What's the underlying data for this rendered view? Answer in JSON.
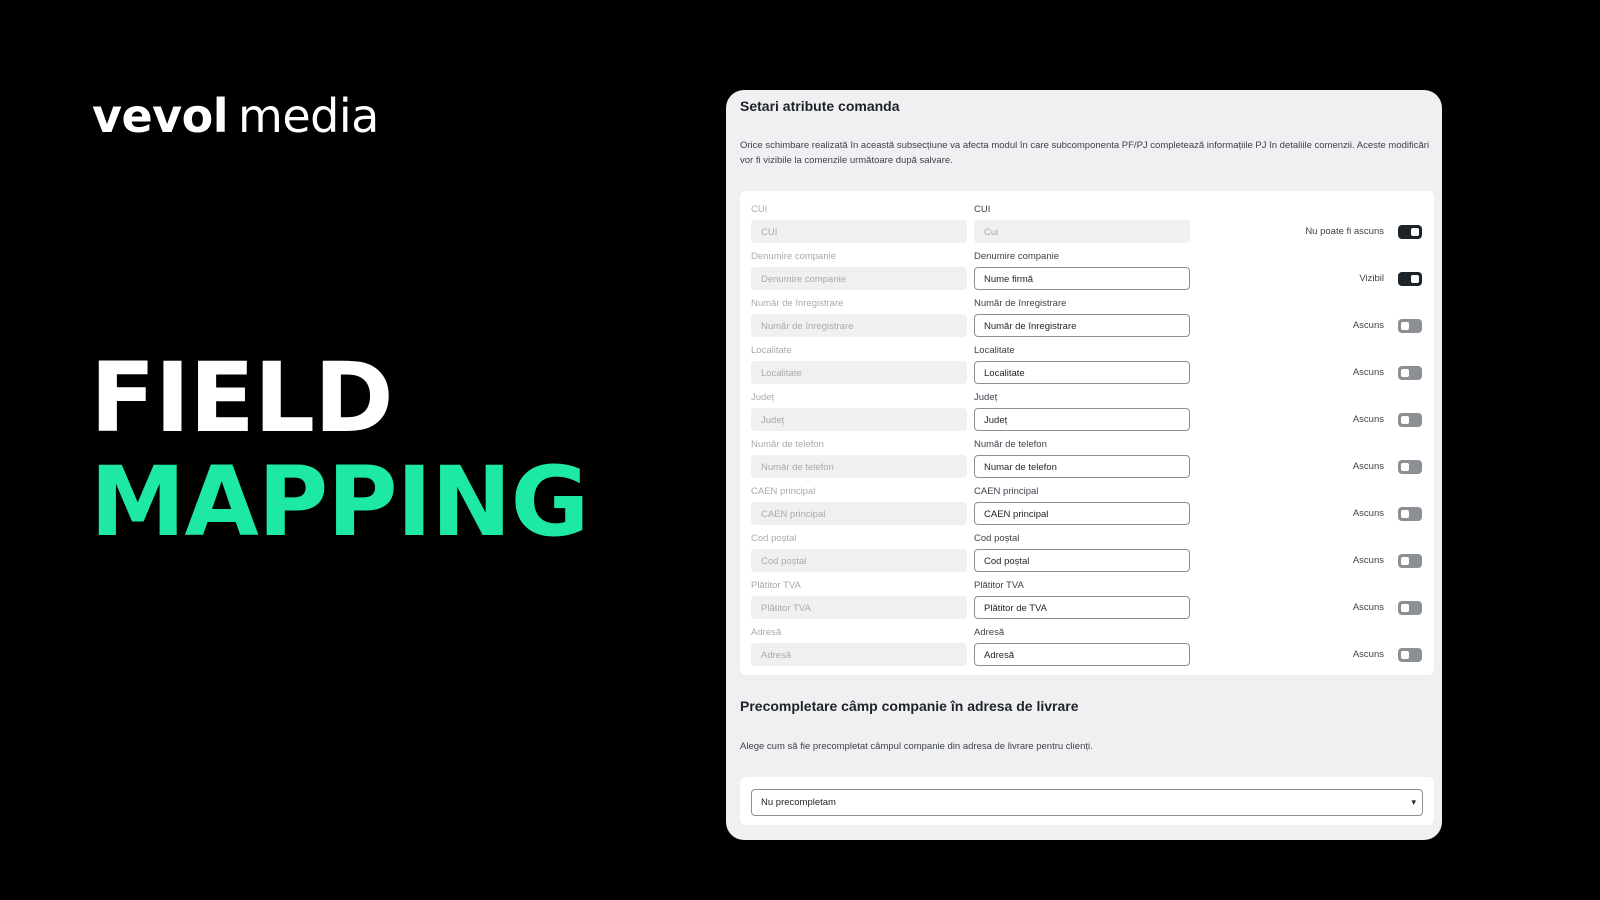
{
  "brand": {
    "logo_part1": "vevol",
    "logo_part2": "media"
  },
  "headline": {
    "line1": "FIELD",
    "line2": "MAPPING"
  },
  "colors": {
    "accent": "#1de9a4",
    "background": "#000000",
    "panel": "#f0f0f3"
  },
  "panel": {
    "title": "Setari atribute comanda",
    "description": "Orice schimbare realizată în această subsecțiune va afecta modul în care subcomponenta PF/PJ completează informațiile PJ în detaliile comenzii. Aceste modificări vor fi vizibile la comenzile următoare după salvare.",
    "fields": [
      {
        "default_label": "CUI",
        "default_placeholder": "CUI",
        "custom_label": "CUI",
        "custom_value": "Cui",
        "custom_editable": false,
        "status": "Nu poate fi ascuns",
        "toggle_on": true
      },
      {
        "default_label": "Denumire companie",
        "default_placeholder": "Denumire companie",
        "custom_label": "Denumire companie",
        "custom_value": "Nume firmă",
        "custom_editable": true,
        "status": "Vizibil",
        "toggle_on": true
      },
      {
        "default_label": "Număr de înregistrare",
        "default_placeholder": "Număr de înregistrare",
        "custom_label": "Număr de înregistrare",
        "custom_value": "Număr de înregistrare",
        "custom_editable": true,
        "status": "Ascuns",
        "toggle_on": false
      },
      {
        "default_label": "Localitate",
        "default_placeholder": "Localitate",
        "custom_label": "Localitate",
        "custom_value": "Localitate",
        "custom_editable": true,
        "status": "Ascuns",
        "toggle_on": false
      },
      {
        "default_label": "Județ",
        "default_placeholder": "Județ",
        "custom_label": "Județ",
        "custom_value": "Județ",
        "custom_editable": true,
        "status": "Ascuns",
        "toggle_on": false
      },
      {
        "default_label": "Număr de telefon",
        "default_placeholder": "Număr de telefon",
        "custom_label": "Număr de telefon",
        "custom_value": "Numar de telefon",
        "custom_editable": true,
        "status": "Ascuns",
        "toggle_on": false
      },
      {
        "default_label": "CAEN principal",
        "default_placeholder": "CAEN principal",
        "custom_label": "CAEN principal",
        "custom_value": "CAEN principal",
        "custom_editable": true,
        "status": "Ascuns",
        "toggle_on": false
      },
      {
        "default_label": "Cod poștal",
        "default_placeholder": "Cod poștal",
        "custom_label": "Cod poștal",
        "custom_value": "Cod poștal",
        "custom_editable": true,
        "status": "Ascuns",
        "toggle_on": false
      },
      {
        "default_label": "Plătitor TVA",
        "default_placeholder": "Plătitor TVA",
        "custom_label": "Plătitor TVA",
        "custom_value": "Plătitor de TVA",
        "custom_editable": true,
        "status": "Ascuns",
        "toggle_on": false
      },
      {
        "default_label": "Adresă",
        "default_placeholder": "Adresă",
        "custom_label": "Adresă",
        "custom_value": "Adresă",
        "custom_editable": true,
        "status": "Ascuns",
        "toggle_on": false
      }
    ]
  },
  "prefill": {
    "title": "Precompletare câmp companie în adresa de livrare",
    "description": "Alege cum să fie precompletat câmpul companie din adresa de livrare pentru clienți.",
    "selected": "Nu precompletam",
    "chevron_icon": "chevron-down-icon"
  }
}
